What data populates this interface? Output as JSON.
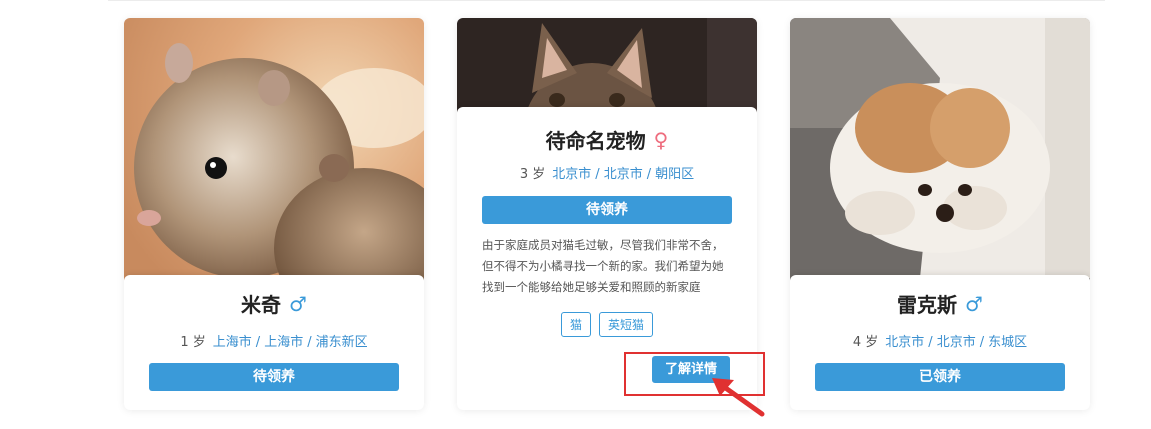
{
  "pets": [
    {
      "name": "米奇",
      "gender_symbol": "♂",
      "age": "1 岁",
      "location": [
        "上海市",
        "上海市",
        "浦东新区"
      ],
      "status": "待领养"
    },
    {
      "name": "待命名宠物",
      "gender_symbol": "♀",
      "age": "3 岁",
      "location": [
        "北京市",
        "北京市",
        "朝阳区"
      ],
      "status": "待领养",
      "description": "由于家庭成员对猫毛过敏，尽管我们非常不舍，但不得不为小橘寻找一个新的家。我们希望为她找到一个能够给她足够关爱和照顾的新家庭",
      "tags": [
        "猫",
        "英短猫"
      ],
      "detail_button": "了解详情"
    },
    {
      "name": "雷克斯",
      "gender_symbol": "♂",
      "age": "4 岁",
      "location": [
        "北京市",
        "北京市",
        "东城区"
      ],
      "status": "已领养"
    }
  ],
  "loc_separator": "/",
  "colors": {
    "accent": "#3a9ad9",
    "male": "#3a9ad9",
    "female": "#ee6d7e",
    "highlight": "#e03131"
  }
}
